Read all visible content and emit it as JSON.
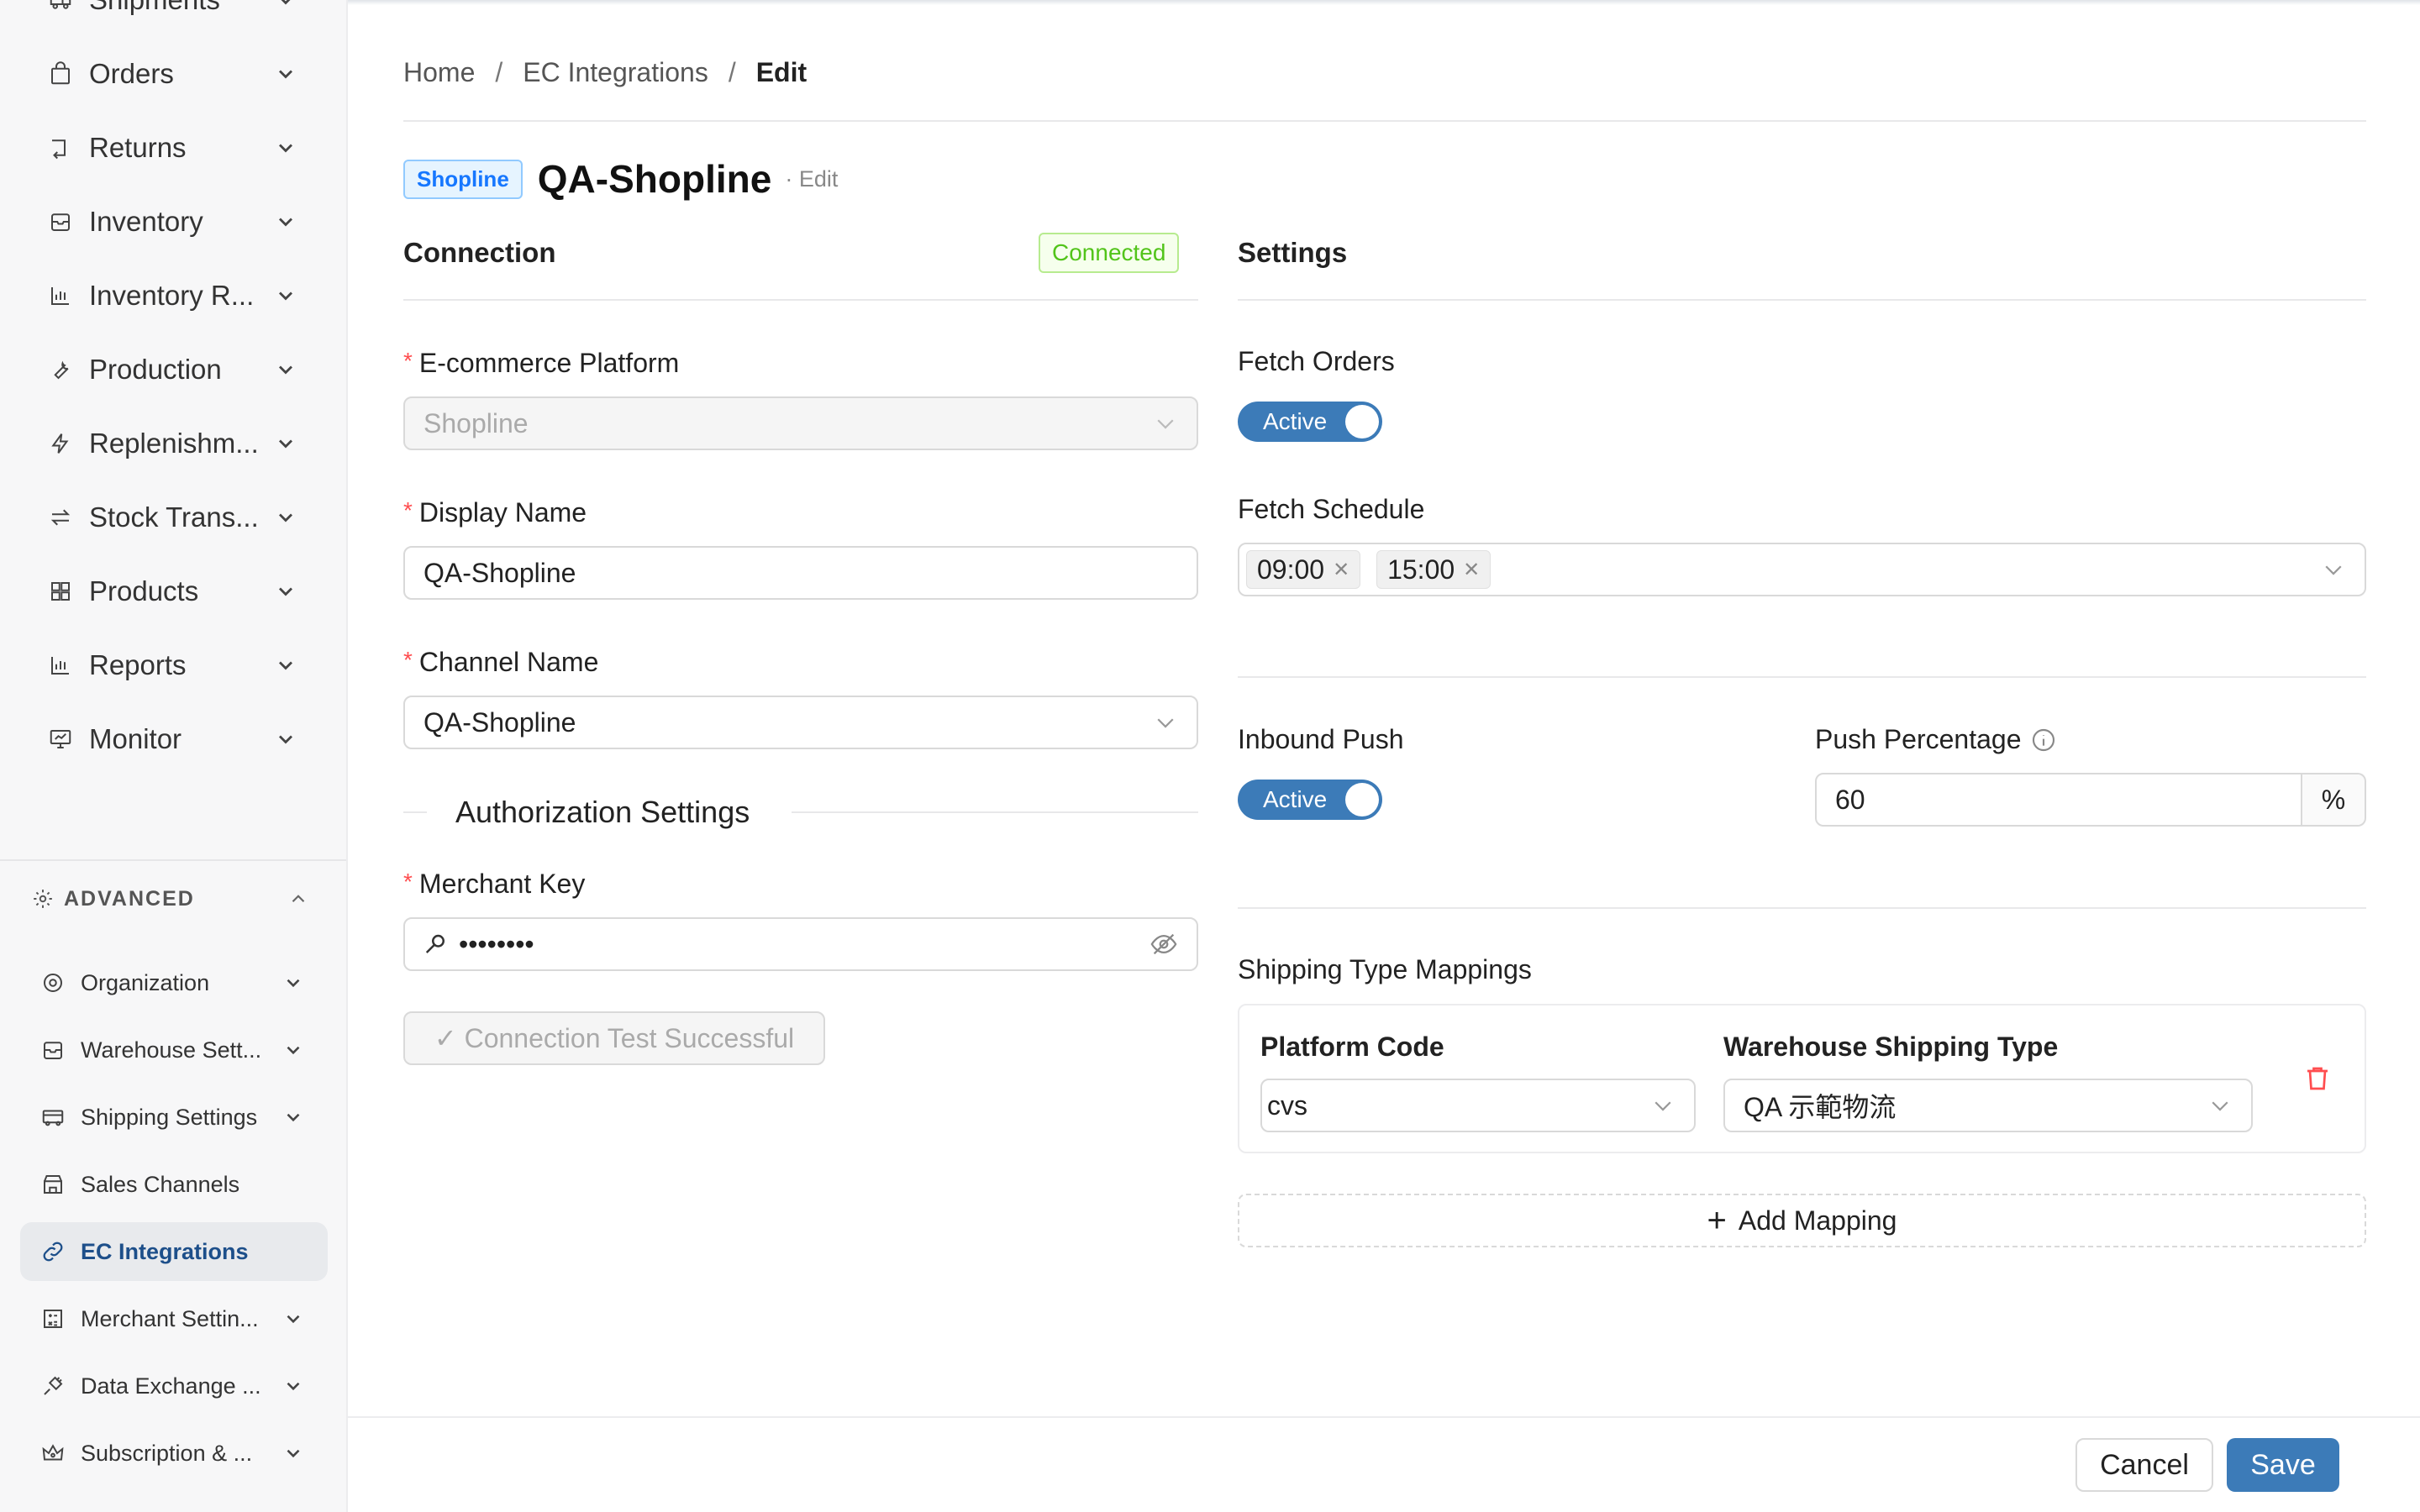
{
  "sidebar": {
    "items": [
      {
        "label": "Shipments",
        "icon": "truck-icon"
      },
      {
        "label": "Orders",
        "icon": "bag-icon"
      },
      {
        "label": "Returns",
        "icon": "return-icon"
      },
      {
        "label": "Inventory",
        "icon": "box-icon"
      },
      {
        "label": "Inventory R...",
        "icon": "chart-icon"
      },
      {
        "label": "Production",
        "icon": "wrench-icon"
      },
      {
        "label": "Replenishm...",
        "icon": "lightning-icon"
      },
      {
        "label": "Stock Trans...",
        "icon": "transfer-icon"
      },
      {
        "label": "Products",
        "icon": "grid-icon"
      },
      {
        "label": "Reports",
        "icon": "chart-icon"
      },
      {
        "label": "Monitor",
        "icon": "monitor-icon"
      }
    ],
    "advanced": {
      "title": "ADVANCED",
      "items": [
        {
          "label": "Organization",
          "icon": "gear-icon"
        },
        {
          "label": "Warehouse Sett...",
          "icon": "box-icon"
        },
        {
          "label": "Shipping Settings",
          "icon": "truck-icon"
        },
        {
          "label": "Sales Channels",
          "icon": "store-icon"
        },
        {
          "label": "EC Integrations",
          "icon": "link-icon"
        },
        {
          "label": "Merchant Settin...",
          "icon": "calc-icon"
        },
        {
          "label": "Data Exchange ...",
          "icon": "plug-icon"
        },
        {
          "label": "Subscription & ...",
          "icon": "crown-icon"
        }
      ]
    }
  },
  "breadcrumb": {
    "home": "Home",
    "section": "EC Integrations",
    "current": "Edit",
    "separator": "/"
  },
  "header": {
    "platform_tag": "Shopline",
    "title": "QA-Shopline",
    "suffix": "· Edit"
  },
  "connection": {
    "title": "Connection",
    "status": "Connected",
    "platform_label": "E-commerce Platform",
    "platform_value": "Shopline",
    "display_name_label": "Display Name",
    "display_name_value": "QA-Shopline",
    "channel_label": "Channel Name",
    "channel_value": "QA-Shopline",
    "auth_title": "Authorization Settings",
    "merchant_key_label": "Merchant Key",
    "merchant_key_value": "••••••••",
    "test_button": "✓ Connection Test Successful"
  },
  "settings": {
    "title": "Settings",
    "fetch_orders_label": "Fetch Orders",
    "fetch_orders_state": "Active",
    "fetch_schedule_label": "Fetch Schedule",
    "fetch_schedule": [
      "09:00",
      "15:00"
    ],
    "inbound_push_label": "Inbound Push",
    "inbound_push_state": "Active",
    "push_percentage_label": "Push Percentage",
    "push_percentage_value": "60",
    "push_percentage_unit": "%",
    "mappings_title": "Shipping Type Mappings",
    "col_platform": "Platform Code",
    "col_warehouse": "Warehouse Shipping Type",
    "mapping_platform_value": "cvs",
    "mapping_warehouse_value": "QA 示範物流",
    "add_mapping": "Add Mapping"
  },
  "footer": {
    "cancel": "Cancel",
    "save": "Save"
  },
  "colors": {
    "accent": "#3c7bb8",
    "success": "#52c41a",
    "danger": "#ff4d4f",
    "tag_blue": "#1677ff"
  }
}
